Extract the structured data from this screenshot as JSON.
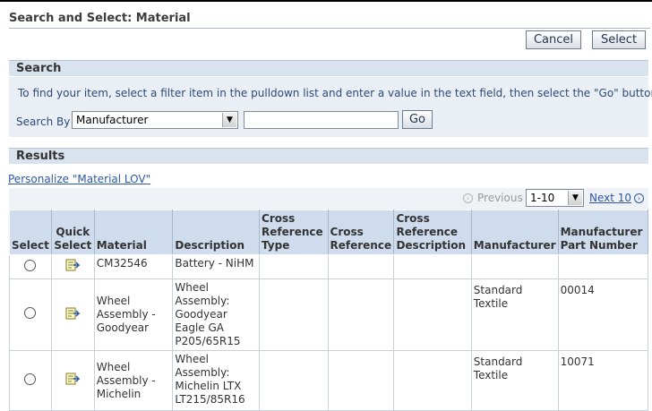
{
  "page": {
    "title": "Search and Select: Material"
  },
  "buttons": {
    "cancel": "Cancel",
    "select": "Select",
    "go": "Go"
  },
  "search": {
    "header": "Search",
    "instructions": "To find your item, select a filter item in the pulldown list and enter a value in the text field, then select the \"Go\" button.",
    "search_by_label": "Search By",
    "search_by_value": "Manufacturer",
    "text_value": ""
  },
  "results": {
    "header": "Results",
    "personalize_link": "Personalize \"Material LOV\"",
    "nav": {
      "previous": "Previous",
      "range": "1-10",
      "next": "Next 10"
    },
    "columns": [
      "Select",
      "Quick Select",
      "Material",
      "Description",
      "Cross Reference Type",
      "Cross Reference",
      "Cross Reference Description",
      "Manufacturer",
      "Manufacturer Part Number"
    ],
    "rows": [
      {
        "material": "CM32546",
        "description": "Battery - NiHM",
        "xref_type": "",
        "xref": "",
        "xref_desc": "",
        "manufacturer": "",
        "part_number": ""
      },
      {
        "material": "Wheel Assembly - Goodyear",
        "description": "Wheel Assembly: Goodyear Eagle GA P205/65R15",
        "xref_type": "",
        "xref": "",
        "xref_desc": "",
        "manufacturer": "Standard Textile",
        "part_number": "00014"
      },
      {
        "material": "Wheel Assembly - Michelin",
        "description": "Wheel Assembly: Michelin LTX LT215/85R16",
        "xref_type": "",
        "xref": "",
        "xref_desc": "",
        "manufacturer": "Standard Textile",
        "part_number": "10071"
      }
    ]
  }
}
